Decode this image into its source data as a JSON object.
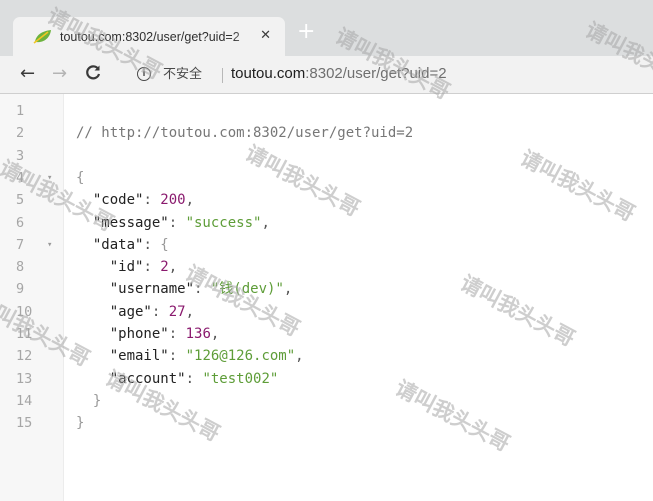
{
  "browser": {
    "tab": {
      "title": "toutou.com:8302/user/get?uid=2",
      "close": "✕"
    },
    "new_tab": "+",
    "nav": {
      "back": "←",
      "forward": "→",
      "reload": "C"
    },
    "security_label": "不安全",
    "address": {
      "host": "toutou.com",
      "rest": ":8302/user/get?uid=2"
    }
  },
  "code_lines": [
    {
      "n": "1"
    },
    {
      "n": "2",
      "comment": "// http://toutou.com:8302/user/get?uid=2"
    },
    {
      "n": "3"
    },
    {
      "n": "4",
      "fold": "▾",
      "brace": "{"
    },
    {
      "n": "5",
      "key": "\"code\"",
      "colon": ": ",
      "num": "200",
      "comma": ","
    },
    {
      "n": "6",
      "key": "\"message\"",
      "colon": ": ",
      "str": "\"success\"",
      "comma": ","
    },
    {
      "n": "7",
      "fold": "▾",
      "key": "\"data\"",
      "colon": ": ",
      "brace": "{"
    },
    {
      "n": "8",
      "key": "\"id\"",
      "colon": ": ",
      "num": "2",
      "comma": ","
    },
    {
      "n": "9",
      "key": "\"username\"",
      "colon": ": ",
      "str": "\"钱(dev)\"",
      "comma": ","
    },
    {
      "n": "10",
      "key": "\"age\"",
      "colon": ": ",
      "num": "27",
      "comma": ","
    },
    {
      "n": "11",
      "key": "\"phone\"",
      "colon": ": ",
      "num": "136",
      "comma": ","
    },
    {
      "n": "12",
      "key": "\"email\"",
      "colon": ": ",
      "str": "\"126@126.com\"",
      "comma": ","
    },
    {
      "n": "13",
      "key": "\"account\"",
      "colon": ": ",
      "str": "\"test002\""
    },
    {
      "n": "14",
      "brace": "}"
    },
    {
      "n": "15",
      "brace": "}"
    }
  ],
  "watermark": "请叫我头头哥"
}
